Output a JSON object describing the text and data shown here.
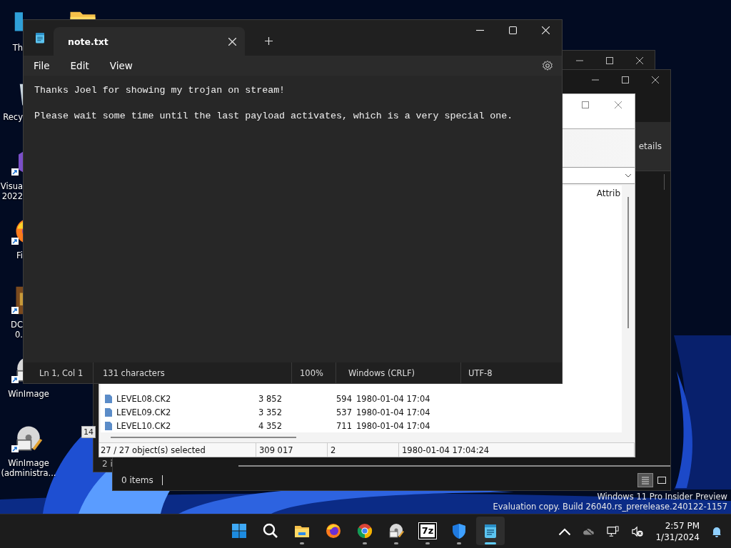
{
  "desktop_icons": [
    {
      "kind": "monitor",
      "lines": [
        "Th"
      ],
      "shortcut": false
    },
    {
      "kind": "recycle-bin",
      "lines": [
        "Recy"
      ],
      "shortcut": false
    },
    {
      "kind": "visual-studio",
      "lines": [
        "Visua",
        "2022"
      ],
      "shortcut": true
    },
    {
      "kind": "firefox",
      "lines": [
        "Fi"
      ],
      "shortcut": true
    },
    {
      "kind": "game",
      "lines": [
        "DC",
        "0."
      ],
      "shortcut": true
    },
    {
      "kind": "winimage",
      "lines": [
        "WinImage"
      ],
      "shortcut": true
    },
    {
      "kind": "winimage",
      "lines": [
        "WinImage",
        "(administra..."
      ],
      "shortcut": true
    }
  ],
  "back_windows": [
    {
      "status": "2 i"
    },
    {
      "status": "0 items",
      "toolbar_label": "etails"
    }
  ],
  "side_fragment": {
    "text": "14"
  },
  "winimage_window": {
    "column_header": "Attrib",
    "rows": [
      {
        "column_1": "LEVEL08.CK2",
        "column_2": "3 852",
        "column_3": "594",
        "column_4": "1980-01-04 17:04"
      },
      {
        "column_1": "LEVEL09.CK2",
        "column_2": "3 352",
        "column_3": "537",
        "column_4": "1980-01-04 17:04"
      },
      {
        "column_1": "LEVEL10.CK2",
        "column_2": "4 352",
        "column_3": "711",
        "column_4": "1980-01-04 17:04"
      }
    ],
    "status": [
      "27 / 27 object(s) selected",
      "309 017",
      "2",
      "1980-01-04 17:04:24"
    ]
  },
  "notepad": {
    "tabs": [
      {
        "title": "note.txt",
        "selected": true
      }
    ],
    "menu": [
      "File",
      "Edit",
      "View"
    ],
    "lines": [
      "Thanks Joel for showing my trojan on stream!",
      "Please wait some time until the last payload activates, which is a very special one."
    ],
    "status": [
      "Ln 1, Col 1",
      "131 characters",
      "100%",
      "Windows (CRLF)",
      "UTF-8"
    ]
  },
  "watermark": [
    "Windows 11 Pro Insider Preview",
    "Evaluation copy. Build 26040.rs_prerelease.240122-1157"
  ],
  "taskbar": {
    "apps": [
      {
        "kind": "start",
        "running": false,
        "selected": false
      },
      {
        "kind": "search",
        "running": false,
        "selected": false
      },
      {
        "kind": "explorer",
        "running": true,
        "selected": false
      },
      {
        "kind": "firefox",
        "running": false,
        "selected": false
      },
      {
        "kind": "chrome",
        "running": true,
        "selected": false
      },
      {
        "kind": "winimage",
        "running": true,
        "selected": false
      },
      {
        "kind": "archive",
        "label": "7z",
        "running": true,
        "selected": false
      },
      {
        "kind": "defender",
        "running": true,
        "selected": false
      },
      {
        "kind": "notepad",
        "running": true,
        "selected": true
      }
    ],
    "time": "2:57 PM",
    "date": "1/31/2024"
  }
}
